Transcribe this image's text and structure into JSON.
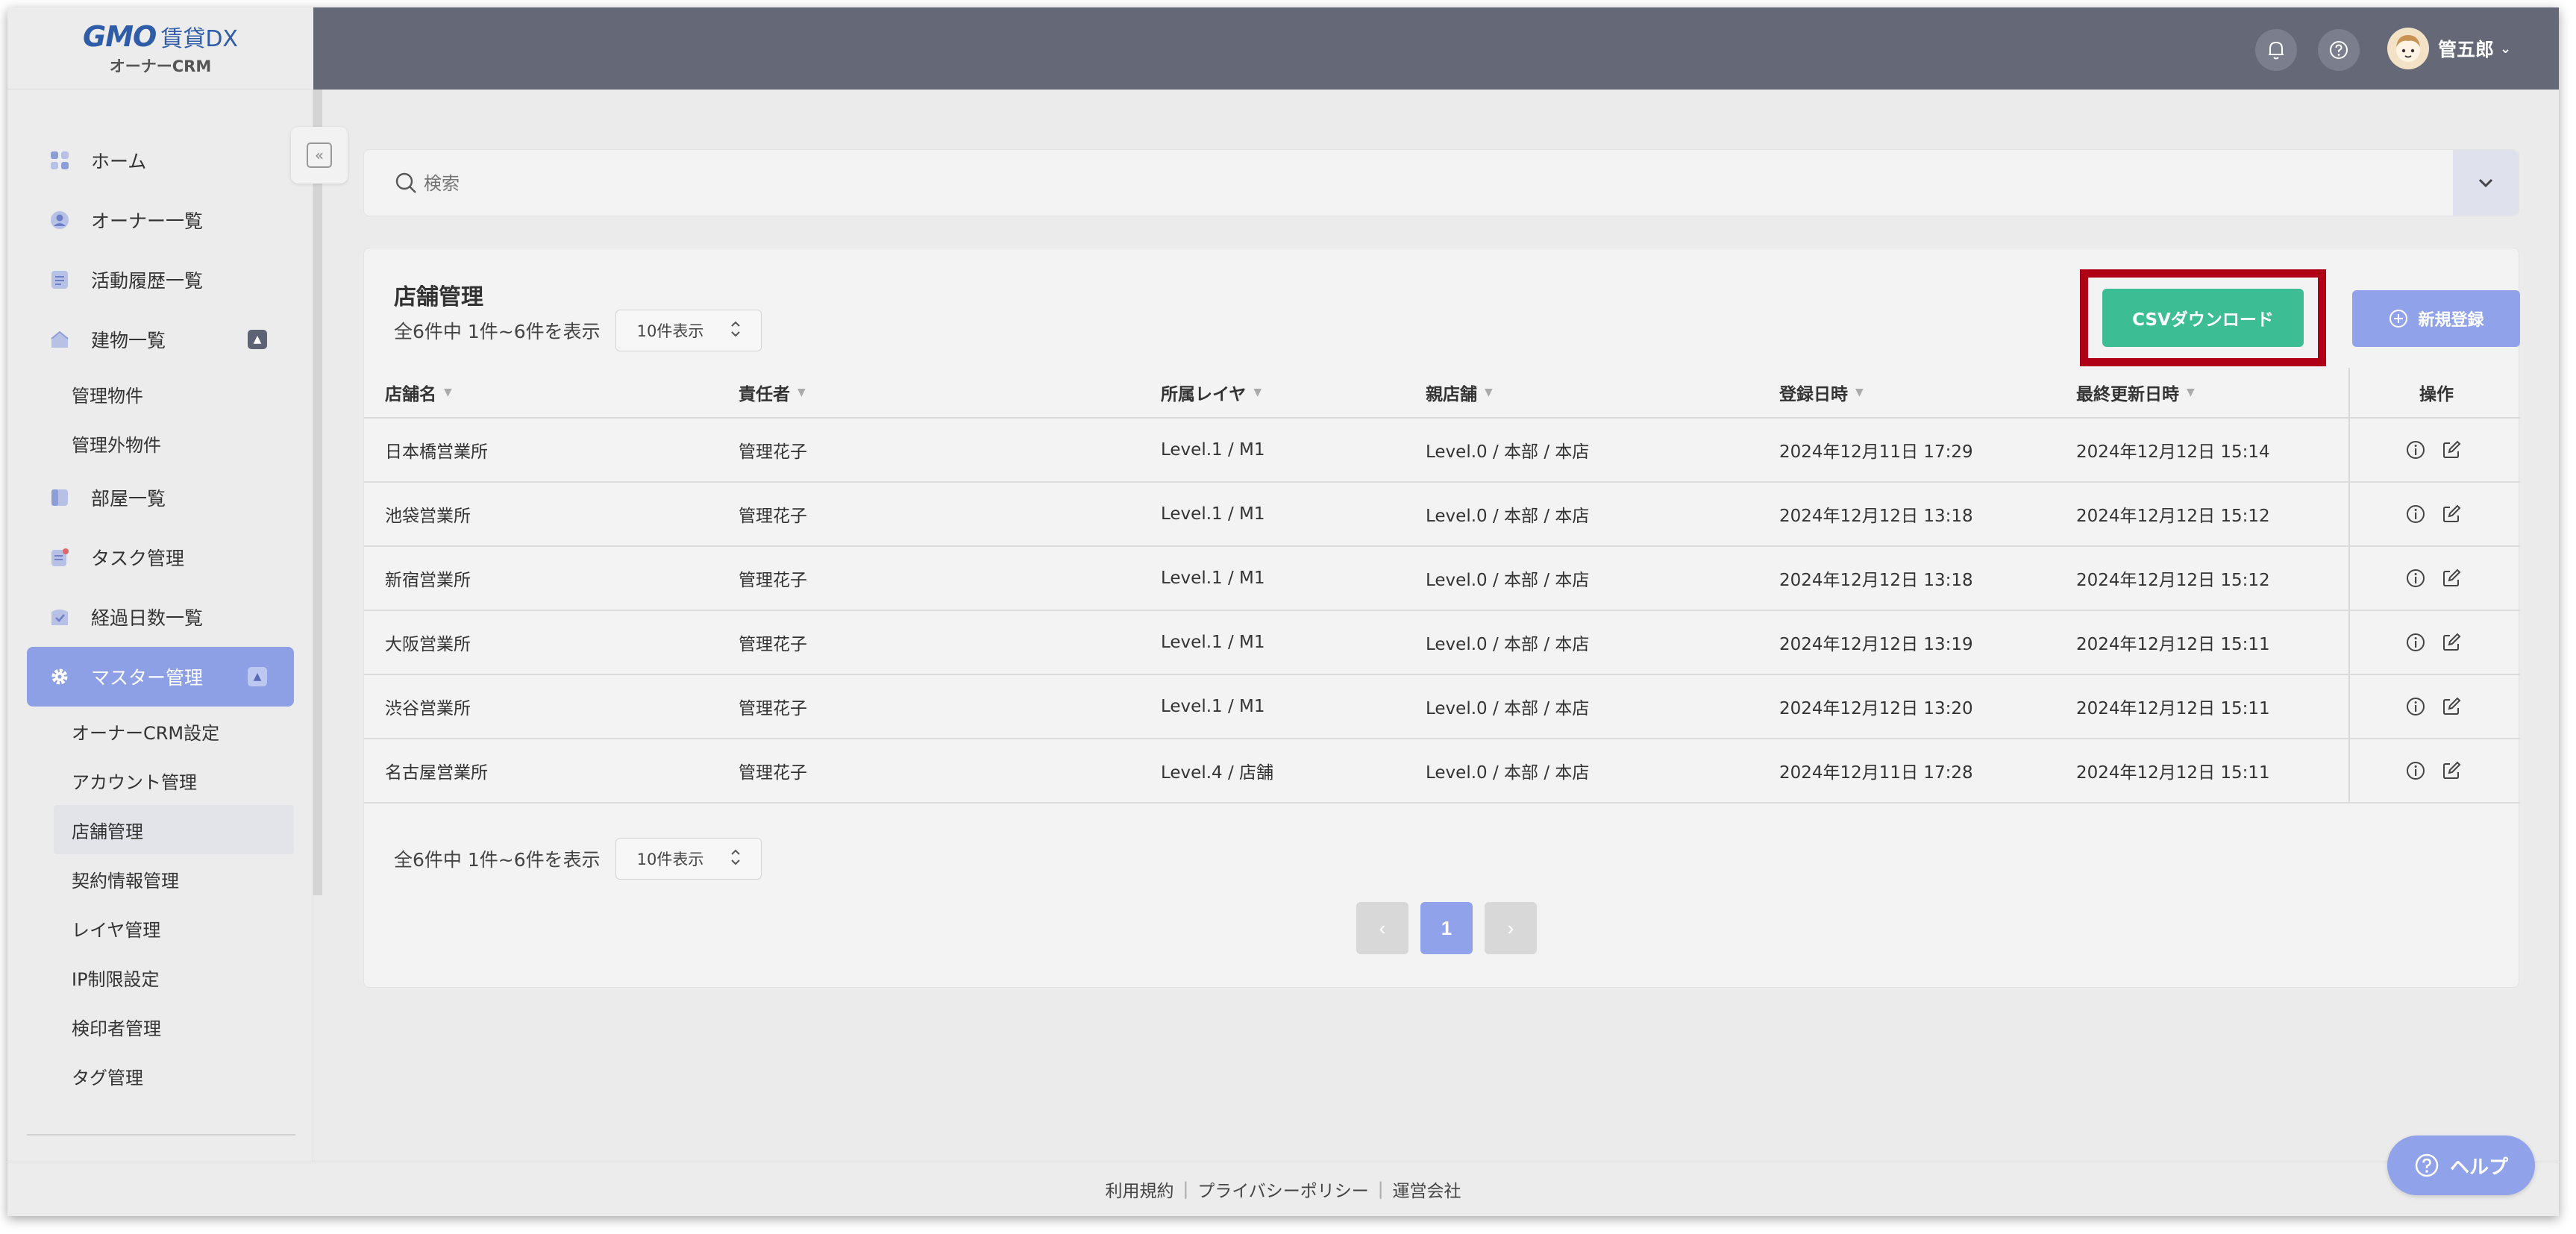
{
  "logo": {
    "brand": "GMO",
    "product": "賃貸DX",
    "sub": "オーナーCRM"
  },
  "header": {
    "user_name": "管五郎"
  },
  "sidebar": {
    "items": [
      {
        "label": "ホーム",
        "icon": "home-grid-icon"
      },
      {
        "label": "オーナー一覧",
        "icon": "owner-icon"
      },
      {
        "label": "活動履歴一覧",
        "icon": "activity-icon"
      },
      {
        "label": "建物一覧",
        "icon": "building-icon",
        "expanded": true
      },
      {
        "label": "部屋一覧",
        "icon": "room-icon"
      },
      {
        "label": "タスク管理",
        "icon": "task-icon"
      },
      {
        "label": "経過日数一覧",
        "icon": "elapsed-icon"
      },
      {
        "label": "マスター管理",
        "icon": "gear-icon",
        "expanded": true,
        "active": true
      }
    ],
    "building_sub": [
      "管理物件",
      "管理外物件"
    ],
    "master_sub": [
      "オーナーCRM設定",
      "アカウント管理",
      "店舗管理",
      "契約情報管理",
      "レイヤ管理",
      "IP制限設定",
      "検印者管理",
      "タグ管理"
    ],
    "selected_sub": "店舗管理"
  },
  "search": {
    "placeholder": "検索"
  },
  "panel": {
    "title": "店舗管理",
    "count_text": "全6件中 1件~6件を表示",
    "per_page": "10件表示",
    "csv_label": "CSVダウンロード",
    "new_label": "新規登録"
  },
  "table": {
    "columns": [
      "店舗名",
      "責任者",
      "所属レイヤ",
      "親店舗",
      "登録日時",
      "最終更新日時",
      "操作"
    ],
    "rows": [
      [
        "日本橋営業所",
        "管理花子",
        "Level.1 / M1",
        "Level.0 / 本部 / 本店",
        "2024年12月11日 17:29",
        "2024年12月12日 15:14"
      ],
      [
        "池袋営業所",
        "管理花子",
        "Level.1 / M1",
        "Level.0 / 本部 / 本店",
        "2024年12月12日 13:18",
        "2024年12月12日 15:12"
      ],
      [
        "新宿営業所",
        "管理花子",
        "Level.1 / M1",
        "Level.0 / 本部 / 本店",
        "2024年12月12日 13:18",
        "2024年12月12日 15:12"
      ],
      [
        "大阪営業所",
        "管理花子",
        "Level.1 / M1",
        "Level.0 / 本部 / 本店",
        "2024年12月12日 13:19",
        "2024年12月12日 15:11"
      ],
      [
        "渋谷営業所",
        "管理花子",
        "Level.1 / M1",
        "Level.0 / 本部 / 本店",
        "2024年12月12日 13:20",
        "2024年12月12日 15:11"
      ],
      [
        "名古屋営業所",
        "管理花子",
        "Level.4 / 店舗",
        "Level.0 / 本部 / 本店",
        "2024年12月11日 17:28",
        "2024年12月12日 15:11"
      ]
    ]
  },
  "pagination": {
    "current": "1"
  },
  "footer": {
    "links": [
      "利用規約",
      "プライバシーポリシー",
      "運営会社"
    ]
  },
  "help": {
    "label": "ヘルプ"
  },
  "colors": {
    "accent": "#8fa2ea",
    "csv": "#3cbd93",
    "header": "#646877",
    "highlight": "#b00016"
  }
}
